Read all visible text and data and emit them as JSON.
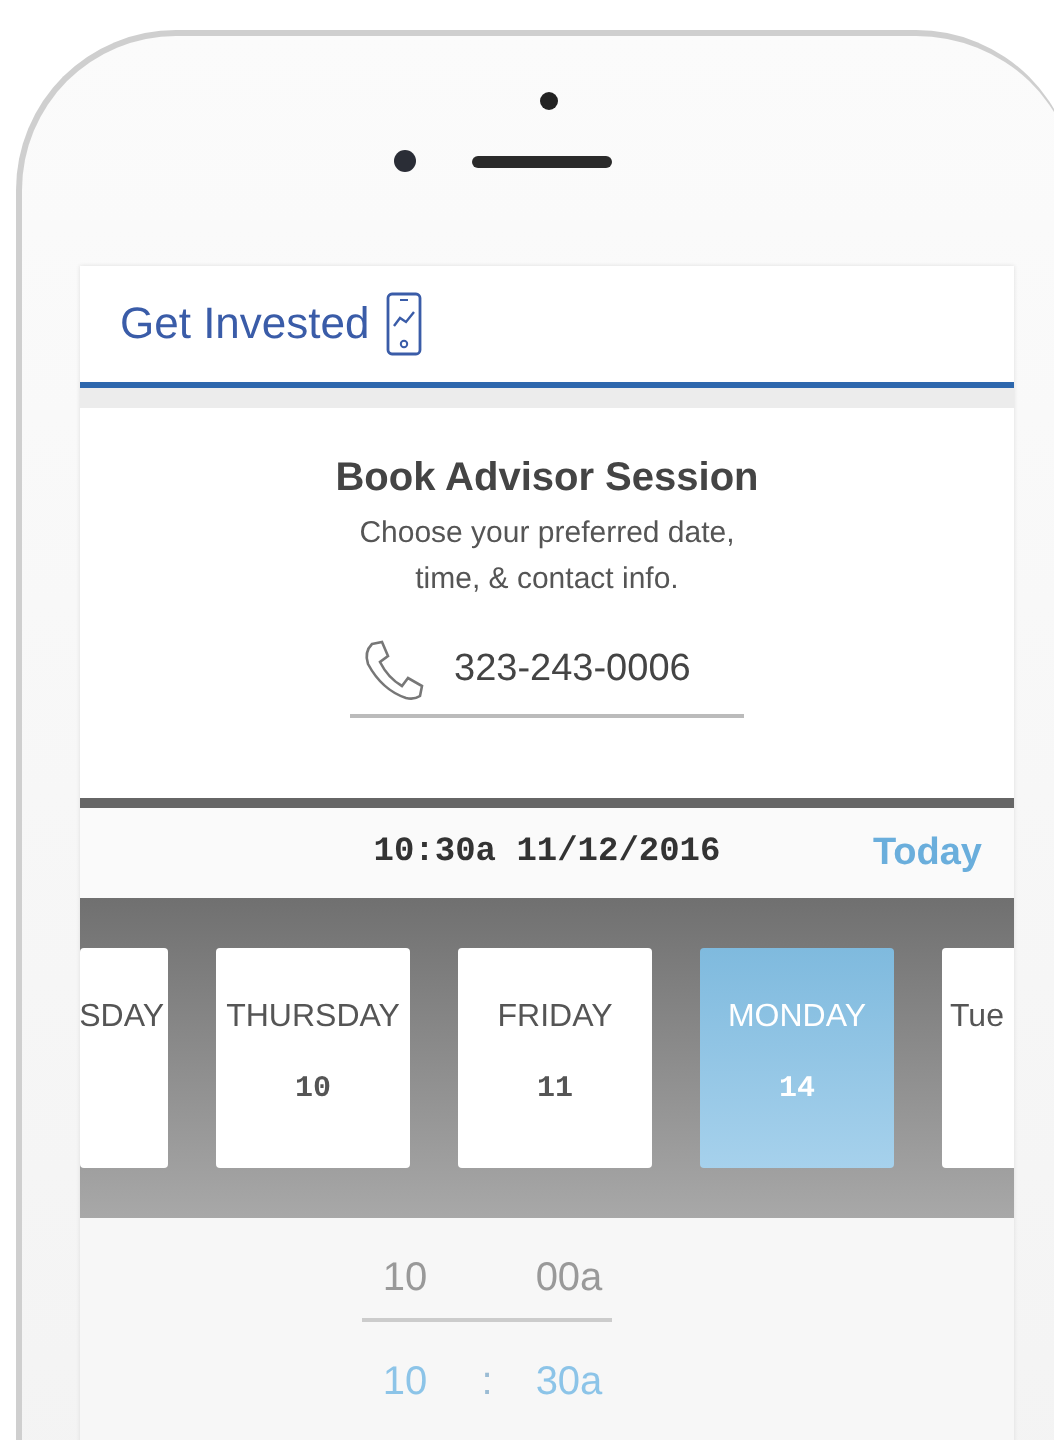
{
  "header": {
    "title": "Get Invested"
  },
  "booking": {
    "title": "Book Advisor Session",
    "subtitle": "Choose your preferred date, time, & contact info.",
    "phone": "323-243-0006"
  },
  "selection": {
    "summary": "10:30a 11/12/2016",
    "today_link": "Today"
  },
  "days": [
    {
      "weekday": "SDAY",
      "selected": false,
      "kind": "partial-left"
    },
    {
      "weekday": "THURSDAY",
      "date": "10",
      "selected": false,
      "kind": "full"
    },
    {
      "weekday": "FRIDAY",
      "date": "11",
      "selected": false,
      "kind": "full"
    },
    {
      "weekday": "MONDAY",
      "date": "14",
      "selected": true,
      "kind": "full"
    },
    {
      "weekday": "Tue",
      "selected": false,
      "kind": "partial-right"
    }
  ],
  "time_rows": [
    {
      "hour": "10",
      "minute": "00a",
      "selected": false
    },
    {
      "hour": "10",
      "separator": ":",
      "minute": "30a",
      "selected": true
    }
  ]
}
